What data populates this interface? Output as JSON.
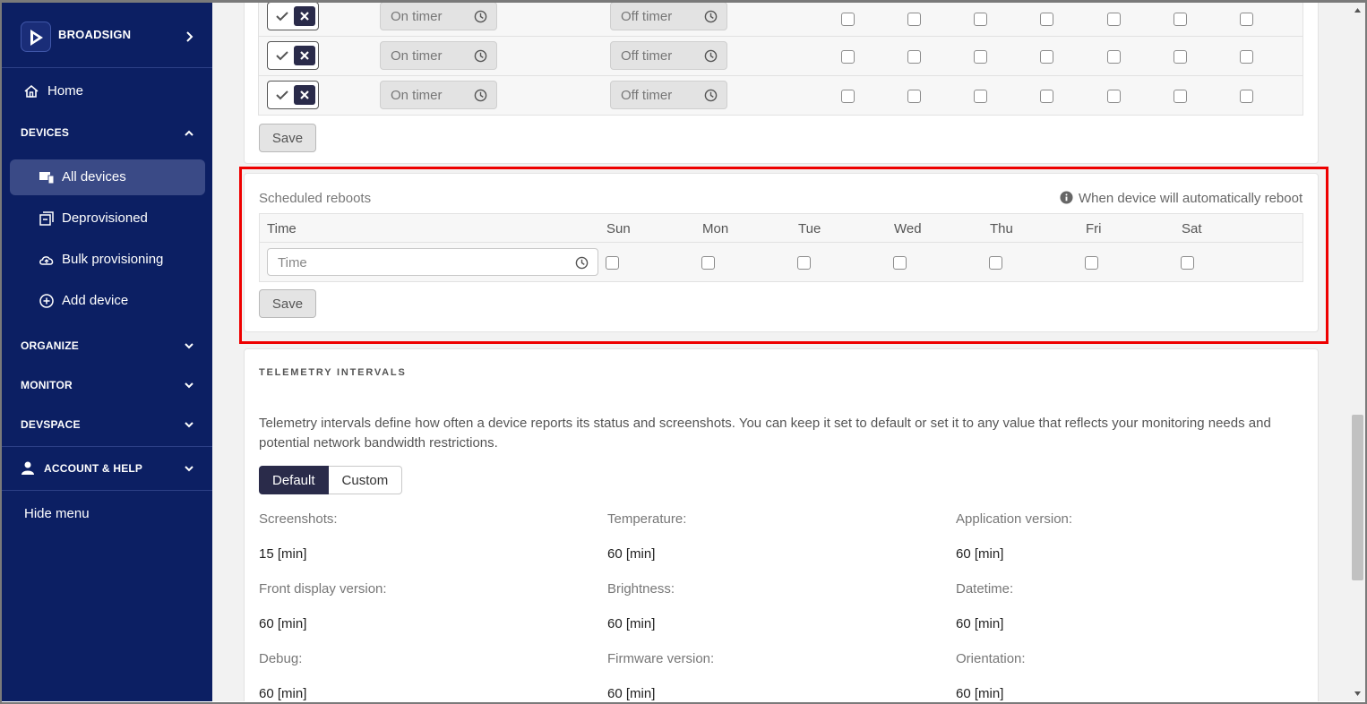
{
  "brand": {
    "name": "BROADSIGN"
  },
  "nav": {
    "home": "Home",
    "devices": "DEVICES",
    "all_devices": "All devices",
    "deprovisioned": "Deprovisioned",
    "bulk_provisioning": "Bulk provisioning",
    "add_device": "Add device",
    "organize": "ORGANIZE",
    "monitor": "MONITOR",
    "devspace": "DEVSPACE",
    "account_help": "ACCOUNT & HELP",
    "hide_menu": "Hide menu"
  },
  "timer_rows": [
    {
      "on_placeholder": "On timer",
      "off_placeholder": "Off timer"
    },
    {
      "on_placeholder": "On timer",
      "off_placeholder": "Off timer"
    },
    {
      "on_placeholder": "On timer",
      "off_placeholder": "Off timer"
    }
  ],
  "timers_save": "Save",
  "reboots": {
    "title": "Scheduled reboots",
    "hint": "When device will automatically reboot",
    "col_time": "Time",
    "days": [
      "Sun",
      "Mon",
      "Tue",
      "Wed",
      "Thu",
      "Fri",
      "Sat"
    ],
    "time_placeholder": "Time",
    "save": "Save"
  },
  "telemetry": {
    "title": "TELEMETRY INTERVALS",
    "description": "Telemetry intervals define how often a device reports its status and screenshots. You can keep it set to default or set it to any value that reflects your monitoring needs and potential network bandwidth restrictions.",
    "tab_default": "Default",
    "tab_custom": "Custom",
    "metrics": [
      {
        "label": "Screenshots:",
        "value": "15 [min]"
      },
      {
        "label": "Temperature:",
        "value": "60 [min]"
      },
      {
        "label": "Application version:",
        "value": "60 [min]"
      },
      {
        "label": "Front display version:",
        "value": "60 [min]"
      },
      {
        "label": "Brightness:",
        "value": "60 [min]"
      },
      {
        "label": "Datetime:",
        "value": "60 [min]"
      },
      {
        "label": "Debug:",
        "value": "60 [min]"
      },
      {
        "label": "Firmware version:",
        "value": "60 [min]"
      },
      {
        "label": "Orientation:",
        "value": "60 [min]"
      }
    ]
  },
  "colors": {
    "sidebar": "#0c1f63",
    "active": "#3a4a86",
    "accent_dark": "#2a2b4a",
    "highlight": "#ee0000"
  }
}
